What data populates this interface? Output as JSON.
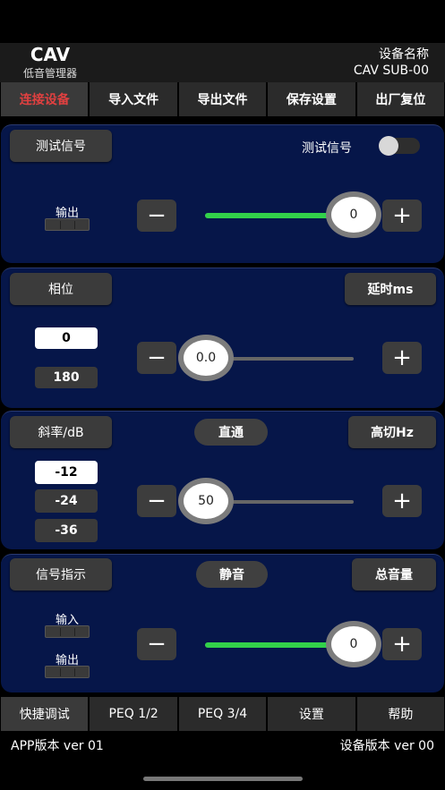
{
  "header": {
    "brand_title": "CAV",
    "brand_sub": "低音管理器",
    "device_label": "设备名称",
    "device_name": "CAV SUB-00"
  },
  "topbar": [
    "连接设备",
    "导入文件",
    "导出文件",
    "保存设置",
    "出厂复位"
  ],
  "test_signal": {
    "button": "测试信号",
    "toggle_label": "测试信号",
    "toggle_on": false,
    "output_label": "输出",
    "slider_value": "0",
    "slider_level": 0.9
  },
  "phase": {
    "button": "相位",
    "delay_button": "延时ms",
    "options": [
      "0",
      "180"
    ],
    "slider_value": "0.0",
    "slider_level": 0.0
  },
  "slope": {
    "button": "斜率/dB",
    "bypass_button": "直通",
    "hicut_button": "高切Hz",
    "options": [
      "-12",
      "-24",
      "-36"
    ],
    "slider_value": "50",
    "slider_level": 0.0
  },
  "signal": {
    "button": "信号指示",
    "mute_button": "静音",
    "master_button": "总音量",
    "input_label": "输入",
    "output_label": "输出",
    "slider_value": "0",
    "slider_level": 0.9
  },
  "controls": {
    "minus": "−",
    "plus": "+"
  },
  "bottombar": [
    "快捷调试",
    "PEQ 1/2",
    "PEQ 3/4",
    "设置",
    "帮助"
  ],
  "footer": {
    "app_version": "APP版本 ver 01",
    "device_version": "设备版本 ver 00"
  },
  "colors": {
    "panel": "#061649",
    "accent_green": "#32d14a",
    "active_red": "#e04040"
  }
}
